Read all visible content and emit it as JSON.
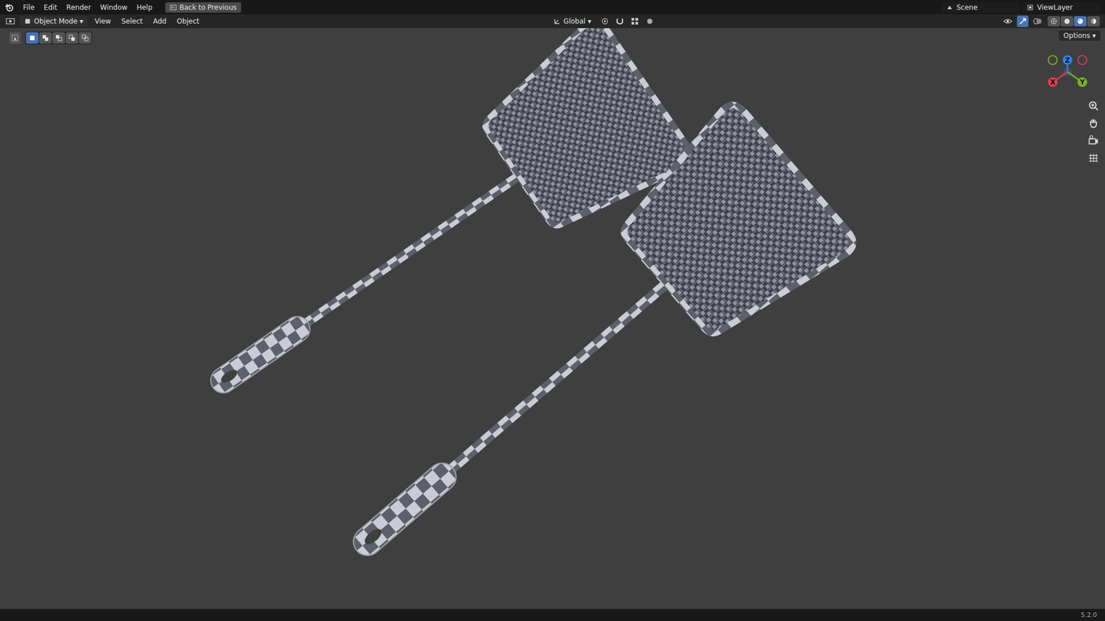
{
  "topbar": {
    "menus": [
      "File",
      "Edit",
      "Render",
      "Window",
      "Help"
    ],
    "back_button": "Back to Previous",
    "scene": "Scene",
    "view_layer": "ViewLayer"
  },
  "header": {
    "mode": "Object Mode",
    "menus": [
      "View",
      "Select",
      "Add",
      "Object"
    ],
    "orientation": "Global",
    "shading_modes": [
      {
        "kind": "wireframe",
        "selected": false
      },
      {
        "kind": "solid",
        "selected": false
      },
      {
        "kind": "material",
        "selected": true
      },
      {
        "kind": "rendered",
        "selected": false
      }
    ]
  },
  "toolbar": {
    "select_modes": [
      {
        "kind": "set",
        "selected": true
      },
      {
        "kind": "extend",
        "selected": false
      },
      {
        "kind": "subtract",
        "selected": false
      },
      {
        "kind": "invert",
        "selected": false
      },
      {
        "kind": "intersect",
        "selected": false
      }
    ],
    "options": "Options"
  },
  "gizmo": {
    "axes": [
      {
        "label": "Z",
        "color": "#2f83e8"
      },
      {
        "label": "X",
        "color": "#e23b53"
      },
      {
        "label": "Y",
        "color": "#7ab51d"
      }
    ]
  },
  "status_bar": {
    "version": "5.2.0"
  }
}
